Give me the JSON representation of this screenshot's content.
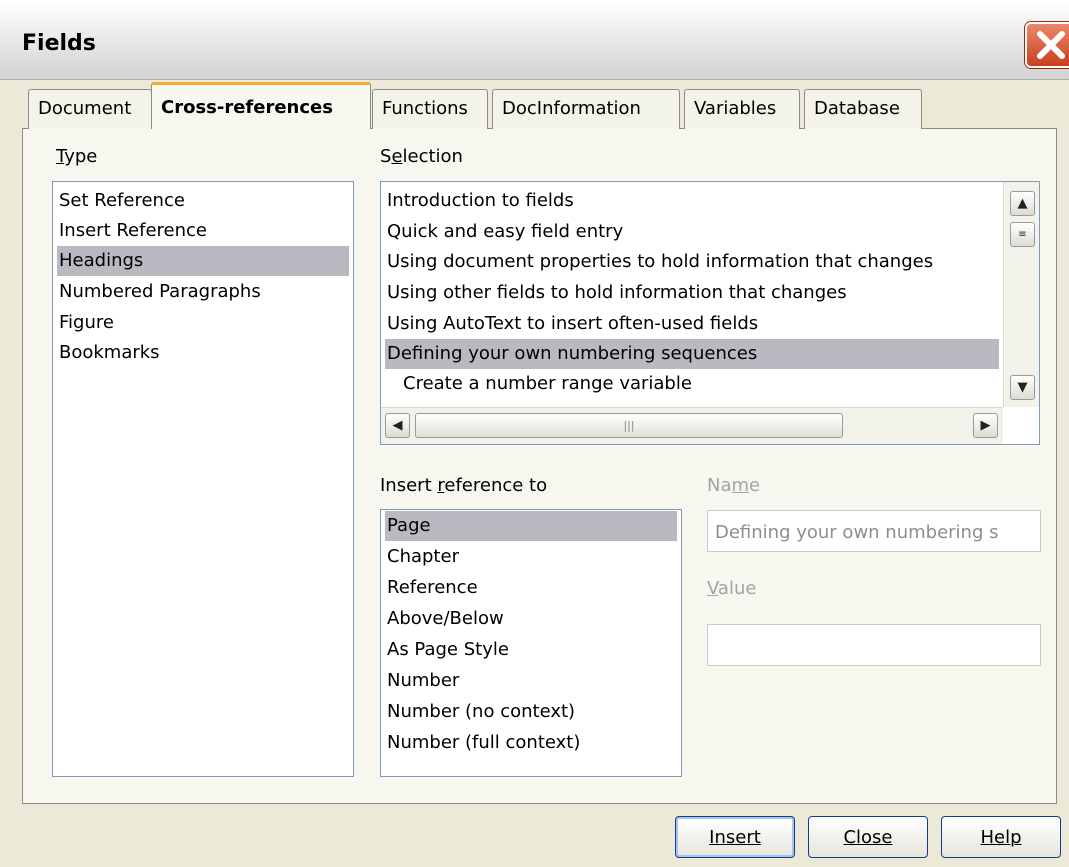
{
  "window": {
    "title": "Fields"
  },
  "tabs": [
    "Document",
    "Cross-references",
    "Functions",
    "DocInformation",
    "Variables",
    "Database"
  ],
  "type": {
    "label_prefix": "",
    "label_underlined": "T",
    "label_rest": "ype",
    "items": [
      "Set Reference",
      "Insert Reference",
      "Headings",
      "Numbered Paragraphs",
      "Figure",
      "Bookmarks"
    ],
    "selected": "Headings"
  },
  "selection": {
    "label_prefix": "S",
    "label_underlined": "e",
    "label_rest": "lection",
    "items": [
      "Introduction to fields",
      "Quick and easy field entry",
      "Using document properties to hold information that changes",
      "Using other fields to hold information that changes",
      "Using AutoText to insert often-used fields",
      "Defining your own numbering sequences",
      "Create a number range variable"
    ],
    "selected": "Defining your own numbering sequences"
  },
  "insert_reference": {
    "label_prefix": "Insert ",
    "label_underlined": "r",
    "label_rest": "eference to",
    "items": [
      "Page",
      "Chapter",
      "Reference",
      "Above/Below",
      "As Page Style",
      "Number",
      "Number (no context)",
      "Number (full context)"
    ],
    "selected": "Page"
  },
  "name": {
    "label_prefix": "Na",
    "label_underlined": "m",
    "label_rest": "e",
    "value": "Defining your own numbering s"
  },
  "value": {
    "label_prefix": "",
    "label_underlined": "V",
    "label_rest": "alue",
    "value": ""
  },
  "buttons": {
    "insert": "Insert",
    "close": "Close",
    "help": "Help"
  },
  "colors": {
    "selected_row": "#b9b9c2",
    "active_tab_accent": "#f2a83a",
    "close_button": "#c8401e",
    "button_border": "#143c8c"
  }
}
